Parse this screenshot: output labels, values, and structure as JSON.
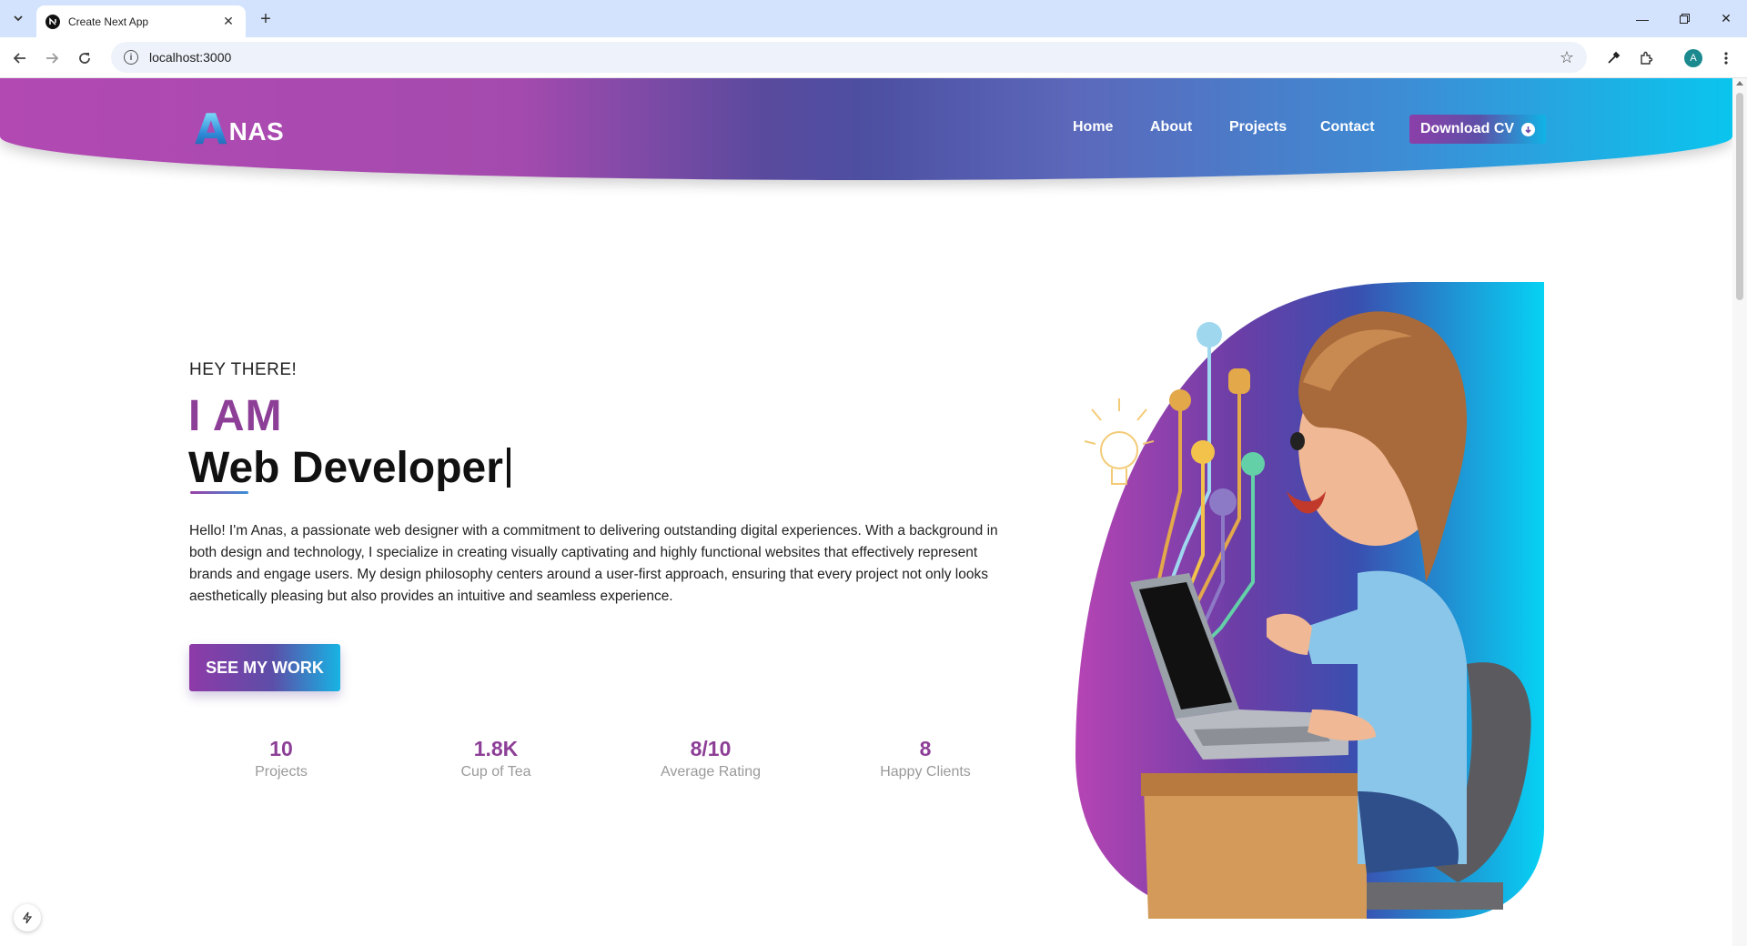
{
  "browser": {
    "tab_title": "Create Next App",
    "url": "localhost:3000",
    "profile_initial": "A",
    "icons": [
      "tab-list-icon",
      "next-favicon-icon",
      "close-icon",
      "plus-icon",
      "minimize-icon",
      "restore-icon",
      "close-window-icon",
      "back-icon",
      "forward-icon",
      "reload-icon",
      "site-info-icon",
      "star-icon",
      "eyedropper-icon",
      "extensions-icon",
      "kebab-menu-icon"
    ]
  },
  "header": {
    "logo_mark": "A",
    "logo_text": "NAS",
    "nav": [
      "Home",
      "About",
      "Projects",
      "Contact"
    ],
    "cta": "Download CV"
  },
  "hero": {
    "greeting": "HEY THERE!",
    "intro": "I AM",
    "role": "Web Developer",
    "bio": "Hello! I'm Anas, a passionate web designer with a commitment to delivering outstanding digital experiences. With a background in both design and technology, I specialize in creating visually captivating and highly functional websites that effectively represent brands and engage users. My design philosophy centers around a user-first approach, ensuring that every project not only looks aesthetically pleasing but also provides an intuitive and seamless experience.",
    "button": "SEE MY WORK"
  },
  "stats": [
    {
      "value": "10",
      "label": "Projects"
    },
    {
      "value": "1.8K",
      "label": "Cup of Tea"
    },
    {
      "value": "8/10",
      "label": "Average Rating"
    },
    {
      "value": "8",
      "label": "Happy Clients"
    }
  ],
  "colors": {
    "accent_purple": "#8d3f97",
    "accent_cyan": "#0ac5ee"
  }
}
